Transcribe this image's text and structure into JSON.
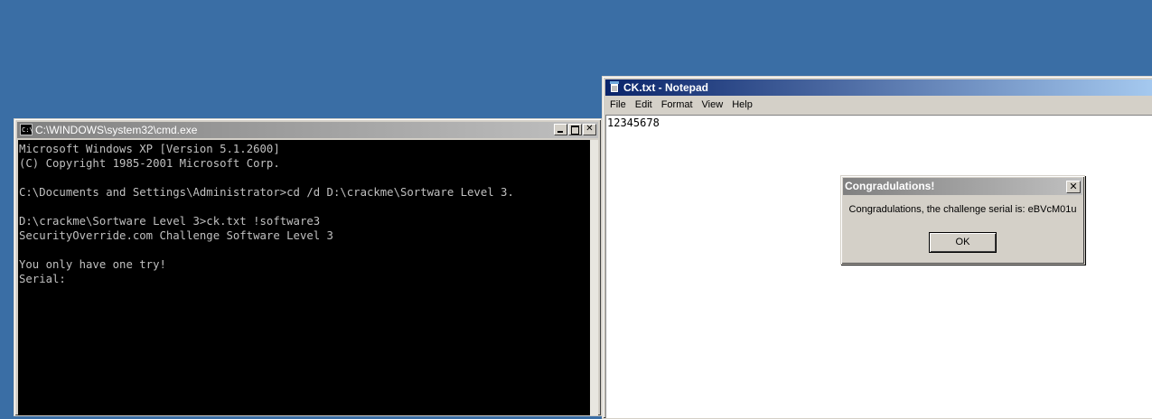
{
  "cmd": {
    "title": "C:\\WINDOWS\\system32\\cmd.exe",
    "console_text": "Microsoft Windows XP [Version 5.1.2600]\n(C) Copyright 1985-2001 Microsoft Corp.\n\nC:\\Documents and Settings\\Administrator>cd /d D:\\crackme\\Sortware Level 3.\n\nD:\\crackme\\Sortware Level 3>ck.txt !software3\nSecurityOverride.com Challenge Software Level 3\n\nYou only have one try!\nSerial:",
    "icon": "console-icon"
  },
  "notepad": {
    "title": "CK.txt - Notepad",
    "menu": [
      "File",
      "Edit",
      "Format",
      "View",
      "Help"
    ],
    "content": "12345678",
    "icon": "notepad-icon"
  },
  "dialog": {
    "title": "Congradulations!",
    "message": "Congradulations, the challenge serial is: eBVcM01u",
    "ok_label": "OK",
    "close_glyph": "✕"
  },
  "colors": {
    "desktop": "#3a6ea5",
    "active_title": "#0a246a",
    "inactive_title": "#808080"
  }
}
